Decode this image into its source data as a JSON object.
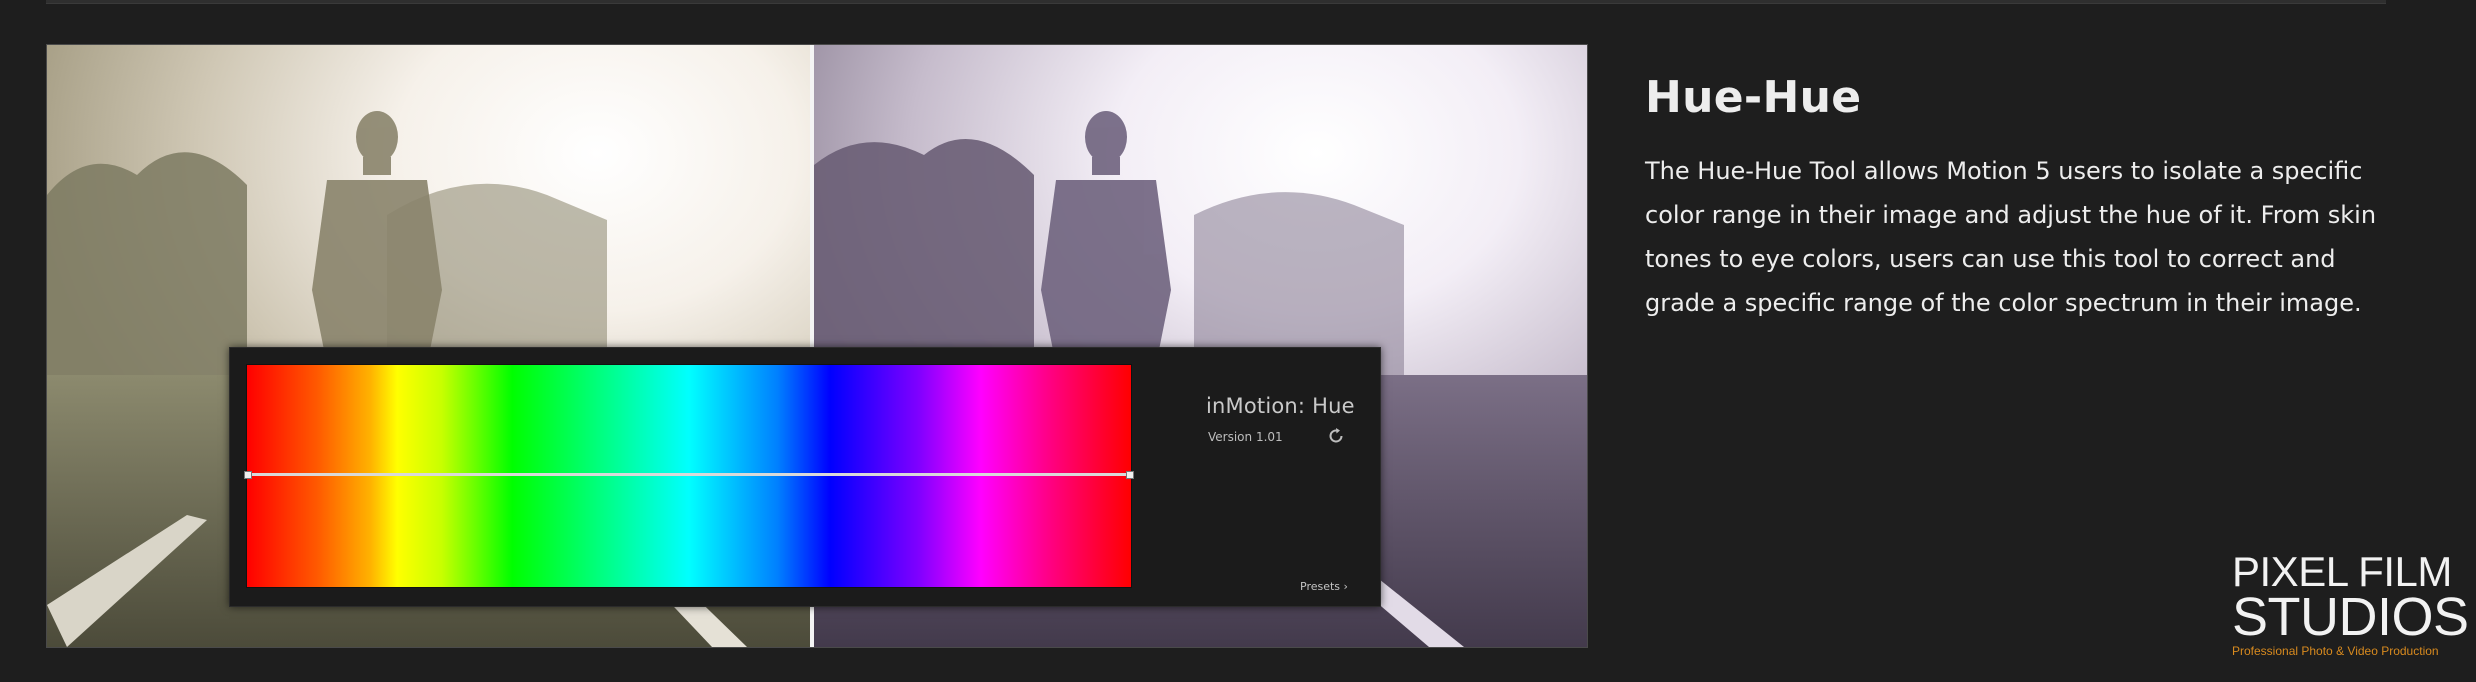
{
  "feature": {
    "title": "Hue-Hue",
    "description": "The Hue-Hue Tool allows Motion 5 users to isolate a specific color range in their image and adjust the hue of it. From skin tones to eye colors, users can use this tool to correct and grade a specific range of the color spectrum in their image."
  },
  "plugin": {
    "name": "inMotion: Hue",
    "version": "Version 1.01",
    "presets_label": "Presets ›",
    "reset_icon": "reset-icon"
  },
  "brand": {
    "line1": "PIXEL FILM",
    "line2": "STUDIOS",
    "tagline": "Professional Photo & Video Production",
    "tagline_color": "#d88a1e"
  },
  "colors": {
    "background": "#1e1e1e",
    "text": "#ededed",
    "panel": "#1b1b1b"
  }
}
